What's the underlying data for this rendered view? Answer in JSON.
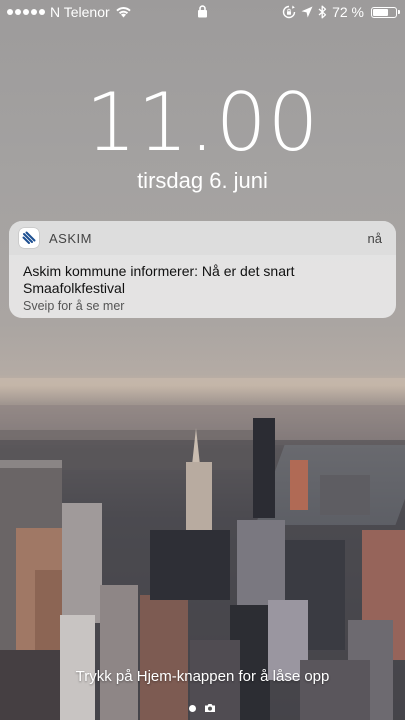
{
  "status_bar": {
    "signal_bars": 5,
    "carrier": "N Telenor",
    "wifi_icon": "wifi-icon",
    "lock_icon": "lock-icon",
    "rotation_lock_icon": "rotation-lock-icon",
    "location_icon": "location-arrow-icon",
    "bluetooth_icon": "bluetooth-icon",
    "battery_percent": "72 %",
    "battery_level": 0.72
  },
  "lock_screen": {
    "time": "11.00",
    "date": "tirsdag 6. juni"
  },
  "notification": {
    "app_icon": "askim-app-icon",
    "app_name": "ASKIM",
    "time": "nå",
    "message": "Askim kommune informerer: Nå er det snart Smaafolkfestival",
    "hint": "Sveip for å se mer"
  },
  "footer": {
    "unlock_hint": "Trykk på Hjem-knappen for å låse opp",
    "page_indicator_icons": [
      "page-dot",
      "camera-icon"
    ]
  },
  "wallpaper": {
    "description_icon": "city-skyline-wallpaper"
  }
}
